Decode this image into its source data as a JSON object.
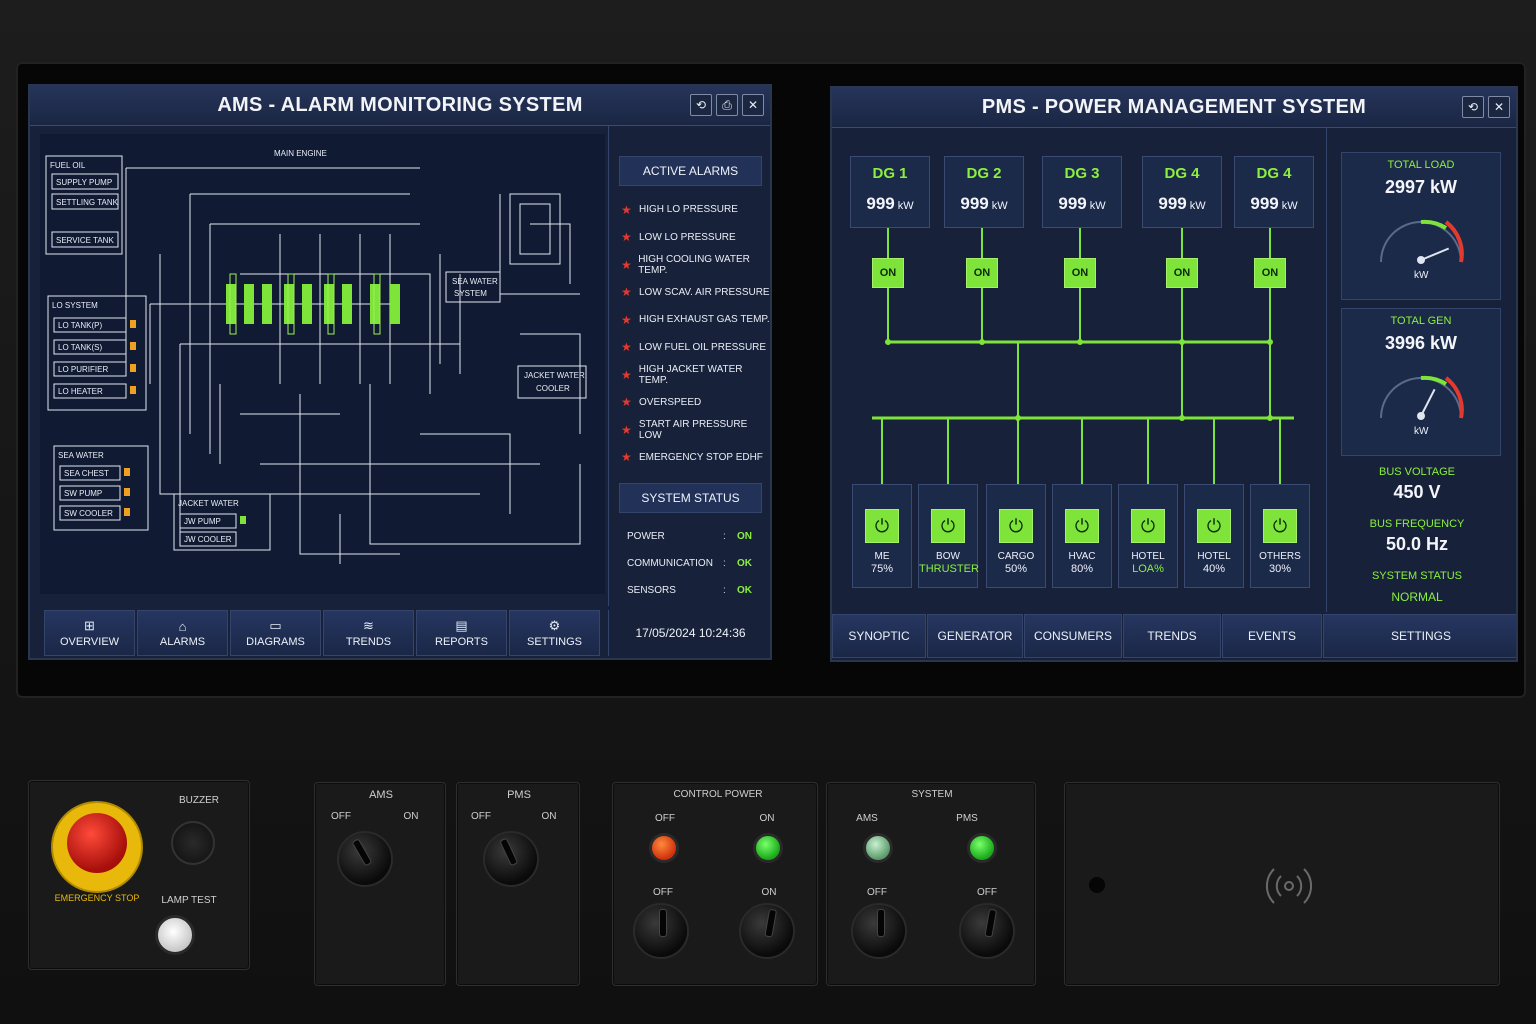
{
  "ams": {
    "title": "AMS - ALARM MONITORING SYSTEM",
    "window_buttons": [
      "⟲",
      "⎙",
      "✕"
    ],
    "diagram": {
      "main_engine": "MAIN ENGINE",
      "fuel_oil": {
        "title": "FUEL OIL",
        "items": [
          "SUPPLY PUMP",
          "SETTLING TANK",
          "SERVICE TANK"
        ]
      },
      "lo_system": {
        "title": "LO SYSTEM",
        "items": [
          "LO TANK(P)",
          "LO TANK(S)",
          "LO PURIFIER",
          "LO HEATER"
        ]
      },
      "sea_water": {
        "title": "SEA WATER",
        "items": [
          "SEA CHEST",
          "SW PUMP",
          "SW COOLER"
        ]
      },
      "jacket_water": {
        "title": "JACKET WATER",
        "items": [
          "JW PUMP",
          "JW COOLER"
        ]
      },
      "sea_water_system": [
        "SEA WATER",
        "SYSTEM"
      ],
      "jacket_water_cooler": [
        "JACKET WATER",
        "COOLER"
      ]
    },
    "active_alarms_title": "ACTIVE ALARMS",
    "alarms": [
      "HIGH LO PRESSURE",
      "LOW LO PRESSURE",
      "HIGH COOLING WATER TEMP.",
      "LOW SCAV. AIR PRESSURE",
      "HIGH EXHAUST GAS TEMP.",
      "LOW FUEL OIL PRESSURE",
      "HIGH JACKET WATER TEMP.",
      "OVERSPEED",
      "START AIR PRESSURE LOW",
      "EMERGENCY STOP EDHF"
    ],
    "system_status_title": "SYSTEM STATUS",
    "system_status": [
      {
        "label": "POWER",
        "value": "ON"
      },
      {
        "label": "COMMUNICATION",
        "value": "OK"
      },
      {
        "label": "SENSORS",
        "value": "OK"
      }
    ],
    "nav": [
      {
        "label": "OVERVIEW",
        "icon": "⊞"
      },
      {
        "label": "ALARMS",
        "icon": "⌂"
      },
      {
        "label": "DIAGRAMS",
        "icon": "▭"
      },
      {
        "label": "TRENDS",
        "icon": "≋"
      },
      {
        "label": "REPORTS",
        "icon": "▤"
      },
      {
        "label": "SETTINGS",
        "icon": "⚙"
      }
    ],
    "datetime": "17/05/2024 10:24:36"
  },
  "pms": {
    "title": "PMS - POWER MANAGEMENT SYSTEM",
    "window_buttons": [
      "⟲",
      "✕"
    ],
    "generators": [
      {
        "name": "DG 1",
        "value": "999",
        "unit": "kW",
        "state": "ON"
      },
      {
        "name": "DG 2",
        "value": "999",
        "unit": "kW",
        "state": "ON"
      },
      {
        "name": "DG 3",
        "value": "999",
        "unit": "kW",
        "state": "ON"
      },
      {
        "name": "DG 4",
        "value": "999",
        "unit": "kW",
        "state": "ON"
      },
      {
        "name": "DG 4",
        "value": "999",
        "unit": "kW",
        "state": "ON"
      }
    ],
    "consumers": [
      {
        "name": "ME",
        "line2": "",
        "pct": "75%"
      },
      {
        "name": "BOW",
        "line2": "THRUSTER",
        "pct": ""
      },
      {
        "name": "CARGO",
        "line2": "",
        "pct": "50%"
      },
      {
        "name": "HVAC",
        "line2": "",
        "pct": "80%"
      },
      {
        "name": "HOTEL",
        "line2": "",
        "pct": "LOA%"
      },
      {
        "name": "HOTEL",
        "line2": "",
        "pct": "40%"
      },
      {
        "name": "OTHERS",
        "line2": "",
        "pct": "30%"
      }
    ],
    "total_load": {
      "label": "TOTAL LOAD",
      "value": "2997 kW",
      "unit": "kW",
      "fraction": 0.75
    },
    "total_gen": {
      "label": "TOTAL GEN",
      "value": "3996 kW",
      "unit": "kW",
      "fraction": 0.6
    },
    "bus_voltage": {
      "label": "BUS VOLTAGE",
      "value": "450 V"
    },
    "bus_frequency": {
      "label": "BUS FREQUENCY",
      "value": "50.0 Hz"
    },
    "system_status": {
      "label": "SYSTEM STATUS",
      "value": "NORMAL"
    },
    "nav": [
      "SYNOPTIC",
      "GENERATOR",
      "CONSUMERS",
      "TRENDS",
      "EVENTS",
      "SETTINGS"
    ]
  },
  "panel": {
    "emergency_stop": "EMERGENCY STOP",
    "buzzer": "BUZZER",
    "lamp_test": "LAMP TEST",
    "ams": {
      "title": "AMS",
      "off": "OFF",
      "on": "ON"
    },
    "pms": {
      "title": "PMS",
      "off": "OFF",
      "on": "ON"
    },
    "control_power": {
      "title": "CONTROL POWER",
      "off": "OFF",
      "on": "ON",
      "off2": "OFF",
      "on2": "ON"
    },
    "system": {
      "title": "SYSTEM",
      "ams": "AMS",
      "pms": "PMS",
      "off": "OFF",
      "off2": "OFF"
    },
    "colors": {
      "red_lamp": "#f0501e",
      "green_lamp": "#3adc3a",
      "amber": "#f0a020",
      "accent_green": "#8cf03c"
    }
  }
}
